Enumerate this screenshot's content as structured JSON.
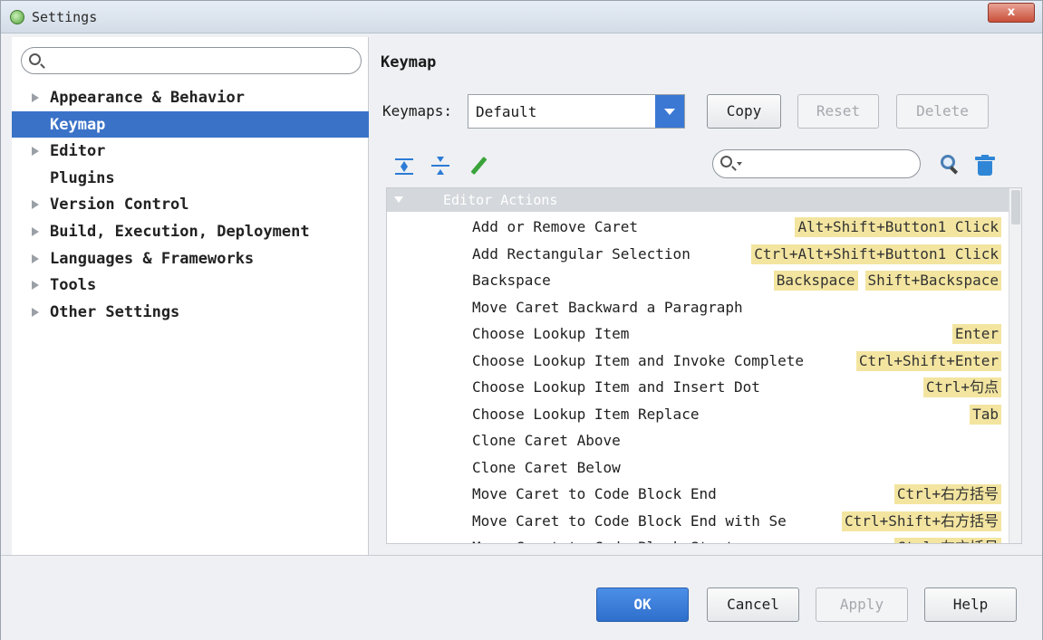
{
  "window": {
    "title": "Settings",
    "close_label": "x"
  },
  "sidebar": {
    "search_placeholder": "",
    "items": [
      {
        "label": "Appearance & Behavior",
        "expandable": true,
        "selected": false
      },
      {
        "label": "Keymap",
        "expandable": false,
        "selected": true
      },
      {
        "label": "Editor",
        "expandable": true,
        "selected": false
      },
      {
        "label": "Plugins",
        "expandable": false,
        "selected": false
      },
      {
        "label": "Version Control",
        "expandable": true,
        "selected": false
      },
      {
        "label": "Build, Execution, Deployment",
        "expandable": true,
        "selected": false
      },
      {
        "label": "Languages & Frameworks",
        "expandable": true,
        "selected": false
      },
      {
        "label": "Tools",
        "expandable": true,
        "selected": false
      },
      {
        "label": "Other Settings",
        "expandable": true,
        "selected": false
      }
    ]
  },
  "main": {
    "title": "Keymap",
    "keymaps_label": "Keymaps:",
    "keymaps_value": "Default",
    "copy_label": "Copy",
    "reset_label": "Reset",
    "delete_label": "Delete",
    "filter_placeholder": "",
    "toolbar_icons": [
      "expand-all-icon",
      "collapse-all-icon",
      "edit-icon",
      "find-shortcut-icon",
      "trash-icon"
    ],
    "group_label": "Editor Actions",
    "actions": [
      {
        "name": "Add or Remove Caret",
        "shortcuts": [
          "Alt+Shift+Button1 Click"
        ]
      },
      {
        "name": "Add Rectangular Selection",
        "shortcuts": [
          "Ctrl+Alt+Shift+Button1 Click"
        ]
      },
      {
        "name": "Backspace",
        "shortcuts": [
          "Backspace",
          "Shift+Backspace"
        ]
      },
      {
        "name": "Move Caret Backward a Paragraph",
        "shortcuts": []
      },
      {
        "name": "Choose Lookup Item",
        "shortcuts": [
          "Enter"
        ]
      },
      {
        "name": "Choose Lookup Item and Invoke Complete",
        "shortcuts": [
          "Ctrl+Shift+Enter"
        ]
      },
      {
        "name": "Choose Lookup Item and Insert Dot",
        "shortcuts": [
          "Ctrl+句点"
        ]
      },
      {
        "name": "Choose Lookup Item Replace",
        "shortcuts": [
          "Tab"
        ]
      },
      {
        "name": "Clone Caret Above",
        "shortcuts": []
      },
      {
        "name": "Clone Caret Below",
        "shortcuts": []
      },
      {
        "name": "Move Caret to Code Block End",
        "shortcuts": [
          "Ctrl+右方括号"
        ]
      },
      {
        "name": "Move Caret to Code Block End with Se",
        "shortcuts": [
          "Ctrl+Shift+右方括号"
        ]
      },
      {
        "name": "Move Caret to Code Block Start",
        "shortcuts": [
          "Ctrl+左方括号"
        ]
      }
    ]
  },
  "footer": {
    "ok_label": "OK",
    "cancel_label": "Cancel",
    "apply_label": "Apply",
    "help_label": "Help"
  },
  "colors": {
    "selection": "#3a72c8",
    "shortcut_highlight": "#f3e5a0",
    "primary_button": "#3a78d4"
  }
}
